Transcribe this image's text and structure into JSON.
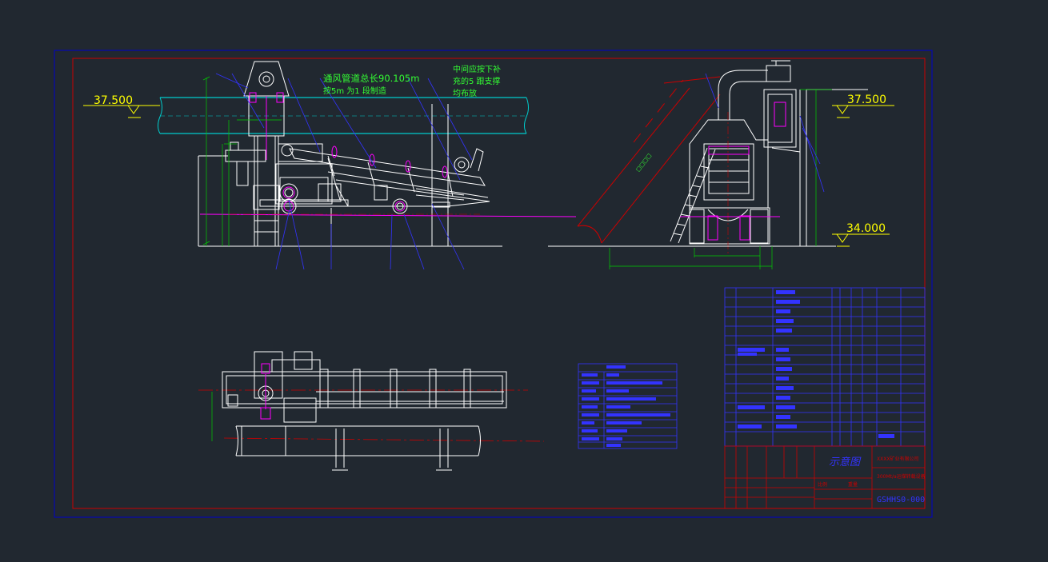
{
  "elevations": {
    "left_top": "37.500",
    "right_top": "37.500",
    "right_bottom": "34.000"
  },
  "notes": {
    "line1": "通风管道总长90.105m",
    "line2": "按5m 为1 段制造",
    "line3": "中间应按下补",
    "line4": "充的5 跟支撑",
    "line5": "均布放"
  },
  "title_block": {
    "drawing_name": "示意图",
    "drawing_number": "GSHHS0-000",
    "company": "XXXX矿业有限公司",
    "project": "300Mt/a运煤转载设备",
    "scale_label": "比例",
    "weight_label": "重量"
  },
  "colors": {
    "background": "#212830",
    "frame": "#0000cc",
    "border": "#cc0000",
    "geometry": "#ffffff",
    "pipe": "#00cccc",
    "dimension": "#00cc00",
    "note": "#33ff33",
    "centerline": "#cc0000",
    "highlight": "#ff00ff",
    "leader": "#3333ff",
    "elevation": "#ffff00"
  }
}
